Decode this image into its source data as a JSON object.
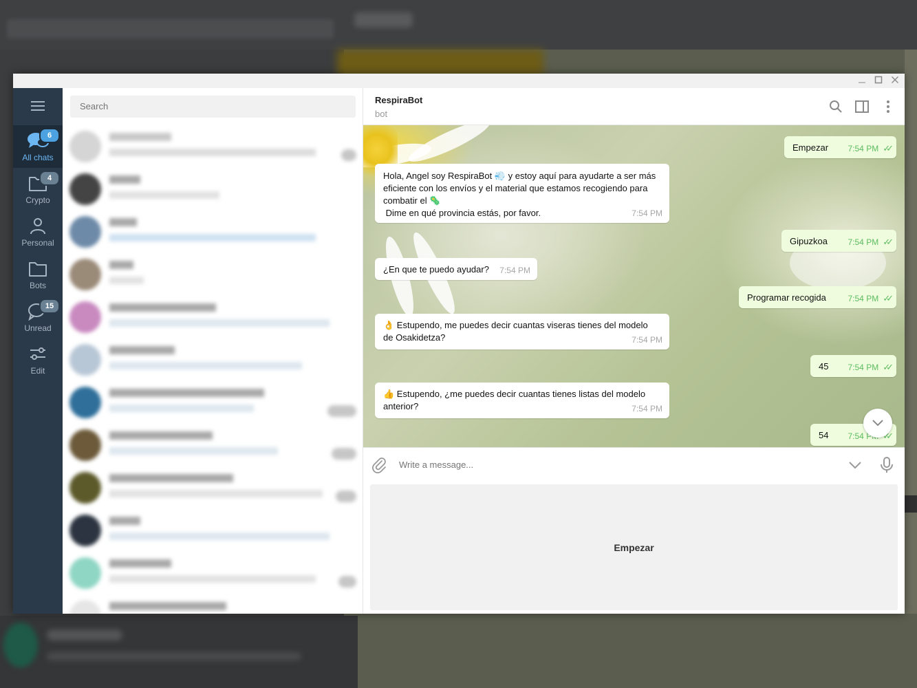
{
  "sidebar": {
    "folders": [
      {
        "label": "All chats",
        "badge": "6",
        "icon": "chats-icon"
      },
      {
        "label": "Crypto",
        "badge": "4",
        "icon": "folder-icon"
      },
      {
        "label": "Personal",
        "badge": "",
        "icon": "person-icon"
      },
      {
        "label": "Bots",
        "badge": "",
        "icon": "folder-icon"
      },
      {
        "label": "Unread",
        "badge": "15",
        "icon": "chat-bubble-icon"
      },
      {
        "label": "Edit",
        "badge": "",
        "icon": "sliders-icon"
      }
    ]
  },
  "search": {
    "placeholder": "Search"
  },
  "conversation": {
    "title": "RespiraBot",
    "subtitle": "bot",
    "messages": [
      {
        "dir": "out",
        "text": "Empezar",
        "time": "7:54 PM"
      },
      {
        "dir": "in",
        "text_lines": [
          "Hola, Angel soy RespiraBot 💨 y estoy aquí para ayudarte a ser más",
          "eficiente con los envíos y el material que estamos recogiendo para",
          "combatir el 🦠",
          " Dime en qué provincia estás, por favor."
        ],
        "time": "7:54 PM"
      },
      {
        "dir": "out",
        "text": "Gipuzkoa",
        "time": "7:54 PM"
      },
      {
        "dir": "in",
        "text": "¿En que te puedo ayudar?",
        "time": "7:54 PM"
      },
      {
        "dir": "out",
        "text": "Programar recogida",
        "time": "7:54 PM"
      },
      {
        "dir": "in",
        "text_lines": [
          "👌 Estupendo, me puedes decir cuantas viseras tienes del modelo",
          "de Osakidetza?"
        ],
        "time": "7:54 PM"
      },
      {
        "dir": "out",
        "text": "45",
        "time": "7:54 PM"
      },
      {
        "dir": "in",
        "text_lines": [
          "👍 Estupendo, ¿me puedes decir cuantas tienes listas del modelo",
          "anterior?"
        ],
        "time": "7:54 PM"
      },
      {
        "dir": "out",
        "text": "54",
        "time": "7:54 PM"
      }
    ],
    "composer_placeholder": "Write a message...",
    "keyboard_button": "Empezar"
  },
  "colors": {
    "sidebar_bg": "#2b3a4a",
    "accent": "#4ca2e0",
    "outgoing_bubble": "#effdde",
    "read_ticks": "#5dbc61"
  }
}
